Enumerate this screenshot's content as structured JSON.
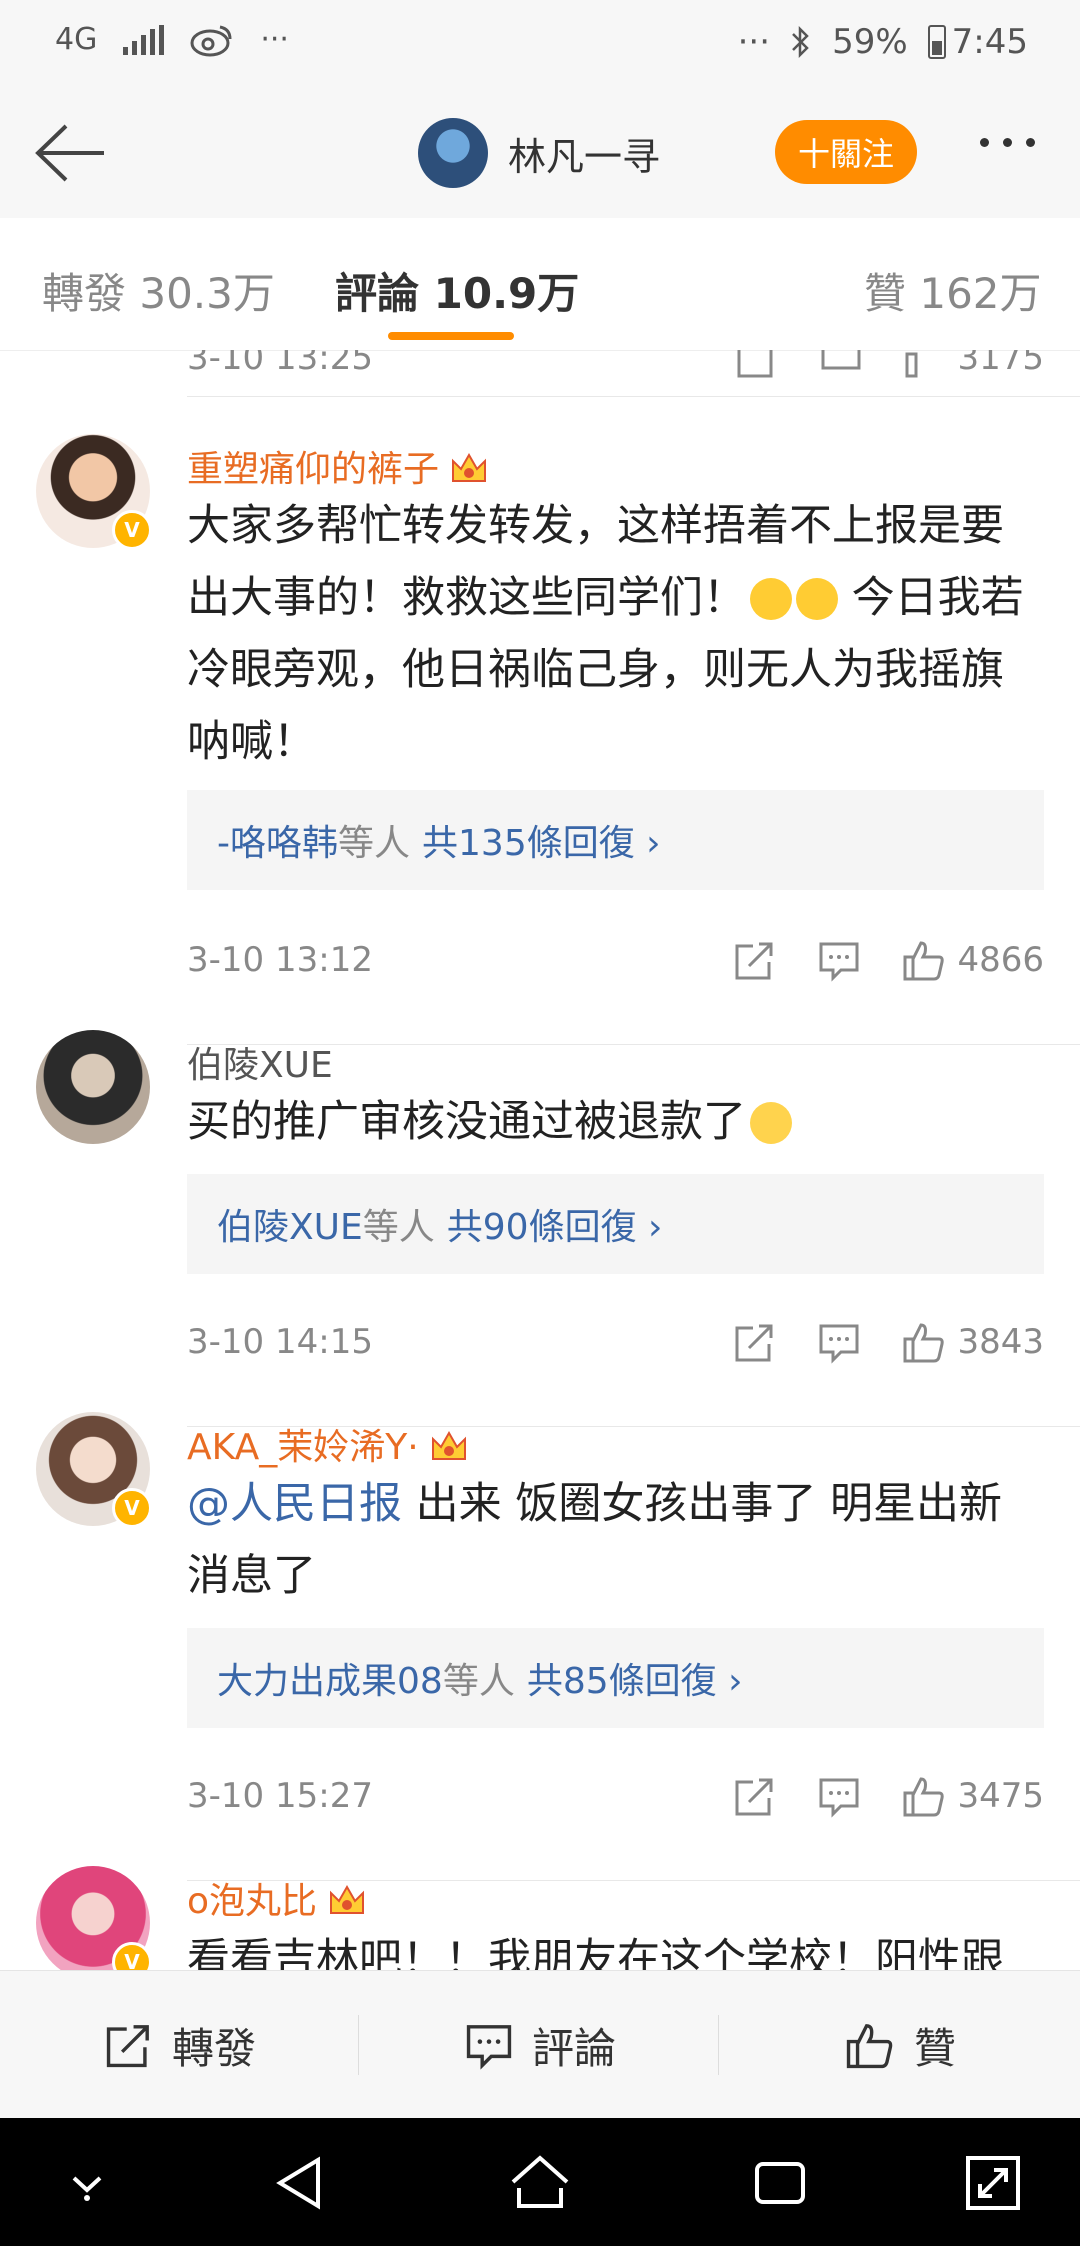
{
  "status_bar": {
    "network": "4G",
    "battery": "59%",
    "time": "7:45"
  },
  "header": {
    "user_name": "林凡一寻",
    "follow_label": "十關注"
  },
  "tabs": [
    {
      "label": "轉發 30.3万"
    },
    {
      "label": "評論 10.9万"
    },
    {
      "label": "贊 162万"
    }
  ],
  "comments": [
    {
      "name": "重塑痛仰的裤子",
      "text_a": "大家多帮忙转发转发，这样捂着不上报是要出大事的！救救这些同学们！",
      "text_b": " 今日我若冷眼旁观，他日祸临己身，则无人为我摇旗呐喊！",
      "reply_user": "-咯咯韩",
      "reply_mid": "等人",
      "reply_count": "共135條回復 ›",
      "time": "3-10 13:12",
      "likes": "4866"
    },
    {
      "name": "伯陵XUE",
      "text_a": "买的推广审核没通过被退款了",
      "reply_user": "伯陵XUE",
      "reply_mid": "等人",
      "reply_count": "共90條回復 ›",
      "time": "3-10 14:15",
      "likes": "3843"
    },
    {
      "name": "AKA_茉姈浠Y·",
      "mention": "@人民日报",
      "text_a": " 出来 饭圈女孩出事了 明星出新消息了",
      "reply_user": "大力出成果08",
      "reply_mid": "等人",
      "reply_count": "共85條回復 ›",
      "time": "3-10 15:27",
      "likes": "3475"
    },
    {
      "name": "o泡丸比",
      "text_a": "看看吉林吧！！我朋友在这个学校！阳性跟"
    }
  ],
  "partial_top": {
    "time": "3-10 13:25",
    "likes": "3175"
  },
  "action_bar": {
    "repost": "轉發",
    "comment": "評論",
    "like": "贊"
  },
  "colors": {
    "accent": "#ff8c00",
    "name_orange": "#e86c23",
    "link_blue": "#3a67a8"
  }
}
